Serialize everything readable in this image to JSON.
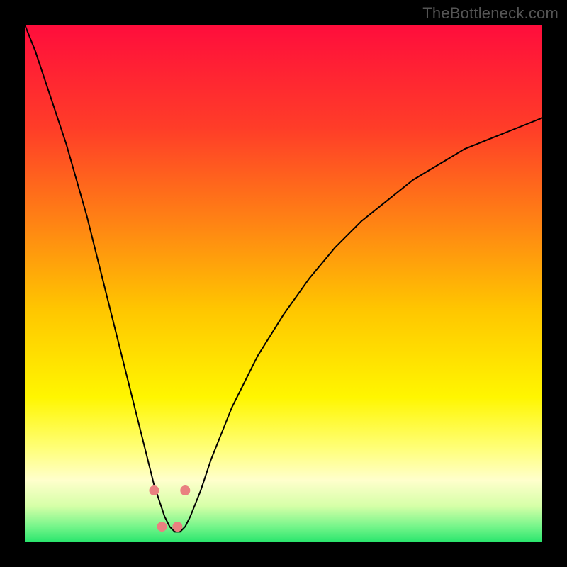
{
  "watermark": "TheBottleneck.com",
  "chart_data": {
    "type": "line",
    "title": "",
    "xlabel": "",
    "ylabel": "",
    "xlim": [
      0,
      100
    ],
    "ylim": [
      0,
      100
    ],
    "grid": false,
    "legend": false,
    "background_gradient": {
      "direction": "vertical",
      "stops": [
        {
          "pos": 0.0,
          "color": "#ff0d3c"
        },
        {
          "pos": 0.2,
          "color": "#ff3d28"
        },
        {
          "pos": 0.4,
          "color": "#ff8a12"
        },
        {
          "pos": 0.55,
          "color": "#ffc600"
        },
        {
          "pos": 0.72,
          "color": "#fff600"
        },
        {
          "pos": 0.82,
          "color": "#ffff7a"
        },
        {
          "pos": 0.88,
          "color": "#ffffcc"
        },
        {
          "pos": 0.93,
          "color": "#d6ffa8"
        },
        {
          "pos": 0.97,
          "color": "#75f58a"
        },
        {
          "pos": 1.0,
          "color": "#29e56d"
        }
      ]
    },
    "series": [
      {
        "name": "bottleneck-curve",
        "color": "#000000",
        "stroke_width": 2,
        "x": [
          0,
          2,
          4,
          6,
          8,
          10,
          12,
          14,
          16,
          18,
          20,
          22,
          24,
          25,
          26,
          27,
          28,
          29,
          30,
          31,
          32,
          34,
          36,
          40,
          45,
          50,
          55,
          60,
          65,
          70,
          75,
          80,
          85,
          90,
          95,
          100
        ],
        "y": [
          100,
          95,
          89,
          83,
          77,
          70,
          63,
          55,
          47,
          39,
          31,
          23,
          15,
          11,
          8,
          5,
          3,
          2,
          2,
          3,
          5,
          10,
          16,
          26,
          36,
          44,
          51,
          57,
          62,
          66,
          70,
          73,
          76,
          78,
          80,
          82
        ]
      }
    ],
    "markers": [
      {
        "name": "valley-left",
        "x": 25,
        "y": 10,
        "color": "#e98080",
        "r": 7
      },
      {
        "name": "valley-right",
        "x": 31,
        "y": 10,
        "color": "#e98080",
        "r": 7
      },
      {
        "name": "valley-bottom-left",
        "x": 26.5,
        "y": 3,
        "color": "#e98080",
        "r": 7
      },
      {
        "name": "valley-bottom-right",
        "x": 29.5,
        "y": 3,
        "color": "#e98080",
        "r": 7
      }
    ]
  }
}
